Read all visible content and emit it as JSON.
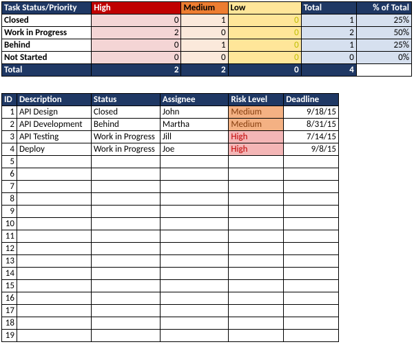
{
  "summary": {
    "headers": {
      "task_status_priority": "Task Status/Priority",
      "high": "High",
      "medium": "Medium",
      "low": "Low",
      "total": "Total",
      "pct_of_total": "% of Total"
    },
    "rows": [
      {
        "label": "Closed",
        "high": "0",
        "medium": "1",
        "low": "0",
        "total": "1",
        "pct": "25%"
      },
      {
        "label": "Work in Progress",
        "high": "2",
        "medium": "0",
        "low": "0",
        "total": "2",
        "pct": "50%"
      },
      {
        "label": "Behind",
        "high": "0",
        "medium": "1",
        "low": "0",
        "total": "1",
        "pct": "25%"
      },
      {
        "label": "Not Started",
        "high": "0",
        "medium": "0",
        "low": "0",
        "total": "0",
        "pct": "0%"
      }
    ],
    "footer": {
      "label": "Total",
      "high": "2",
      "medium": "2",
      "low": "0",
      "total": "4",
      "pct": ""
    }
  },
  "tasks": {
    "headers": {
      "id": "ID",
      "description": "Description",
      "status": "Status",
      "assignee": "Assignee",
      "risk_level": "Risk Level",
      "deadline": "Deadline"
    },
    "rows": [
      {
        "id": "1",
        "description": "API Design",
        "status": "Closed",
        "assignee": "John",
        "risk": "Medium",
        "risk_class": "risk-medium",
        "deadline": "9/18/15"
      },
      {
        "id": "2",
        "description": "API Development",
        "status": "Behind",
        "assignee": "Martha",
        "risk": "Medium",
        "risk_class": "risk-medium",
        "deadline": "8/31/15"
      },
      {
        "id": "3",
        "description": "API Testing",
        "status": "Work in Progress",
        "assignee": "Jill",
        "risk": "High",
        "risk_class": "risk-high",
        "deadline": "7/14/15"
      },
      {
        "id": "4",
        "description": "Deploy",
        "status": "Work in Progress",
        "assignee": "Joe",
        "risk": "High",
        "risk_class": "risk-high",
        "deadline": "9/8/15"
      }
    ],
    "empty_rows": [
      "5",
      "6",
      "7",
      "8",
      "9",
      "10",
      "11",
      "12",
      "13",
      "14",
      "15",
      "16",
      "17",
      "18",
      "19"
    ]
  }
}
